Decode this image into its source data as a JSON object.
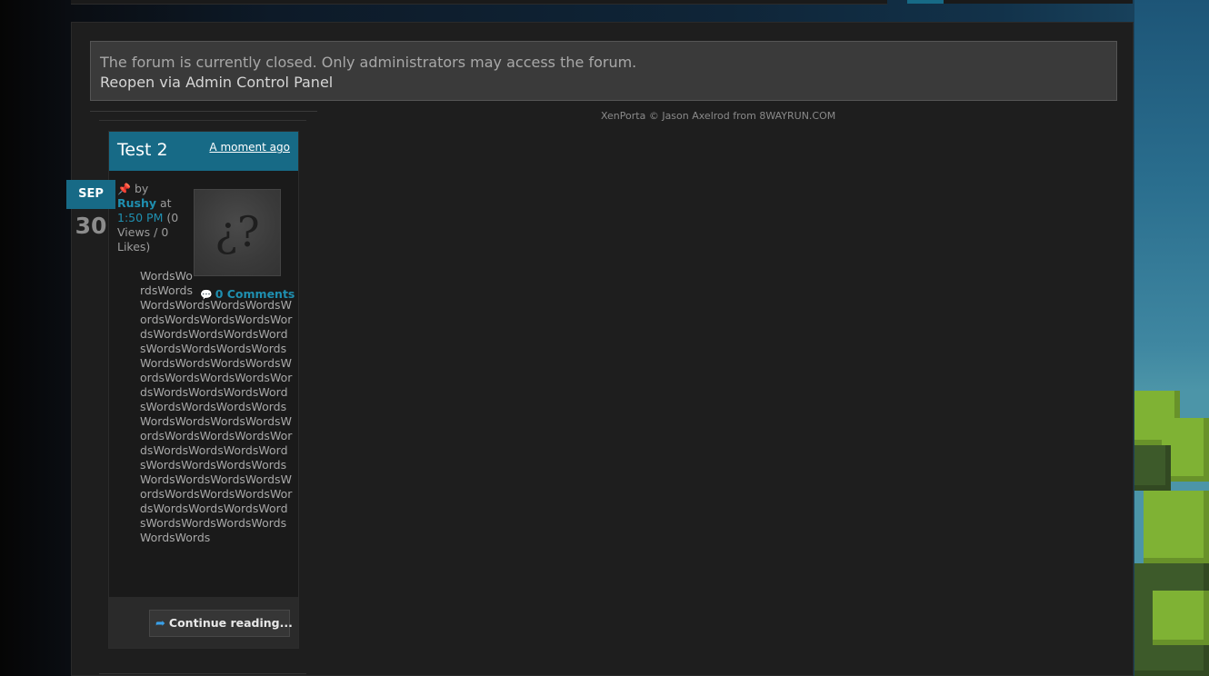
{
  "notice": {
    "message": "The forum is currently closed. Only administrators may access the forum.",
    "reopen_link": "Reopen via Admin Control Panel"
  },
  "credit": "XenPorta © Jason Axelrod from 8WAYRUN.COM",
  "article": {
    "title": "Test 2",
    "posted_ago": "A moment ago",
    "date_month": "SEP",
    "date_day": "30",
    "by_label": "by",
    "author": "Rushy",
    "at_label": "at",
    "time": "1:50 PM",
    "stats": "(0 Views / 0 Likes)",
    "thumb_glyph": "¿?",
    "comments": "0 Comments",
    "text_narrow": "WordsWordsWords",
    "text_wide": "WordsWordsWordsWordsWordsWordsWordsWordsWordsWordsWordsWordsWordsWordsWordsWordsWordsWordsWordsWordsWordsWordsWordsWordsWordsWordsWordsWordsWordsWordsWordsWordsWordsWordsWordsWordsWordsWordsWordsWordsWordsWordsWordsWordsWordsWordsWordsWordsWordsWordsWordsWordsWordsWordsWordsWordsWordsWordsWordsWordsWordsWordsWordsWordsWordsWordsWordsWordsWordsWords",
    "continue_label": "Continue reading..."
  },
  "colors": {
    "accent": "#176a86",
    "link": "#1f8fb0",
    "panel_bg": "#1e1e1e",
    "notice_bg": "#3a3a3a"
  },
  "icons": {
    "pin": "pin-icon",
    "comment": "comment-bubble-icon",
    "continue": "curved-arrow-icon"
  }
}
